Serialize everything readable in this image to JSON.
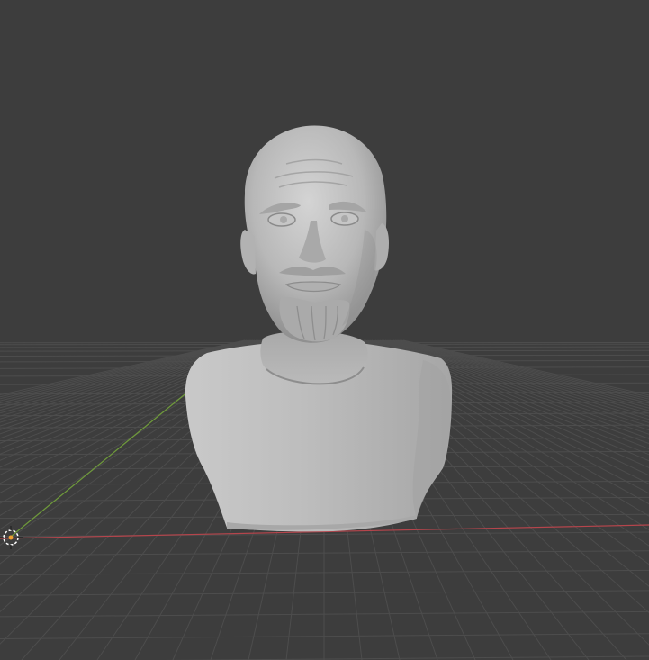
{
  "viewport": {
    "background": "#3d3d3d",
    "grid_color": "#4d4d4d",
    "x_axis_color": "#b5454c",
    "y_axis_color": "#6f9a3b",
    "model_color": "#b9b9b9",
    "model_shadow": "#8e8e8e",
    "origin_marker_color": "#f0a030"
  },
  "scene": {
    "object_type": "sculpted-bust",
    "grid_visible": true,
    "axes_visible": [
      "x",
      "y"
    ]
  },
  "icons": {
    "origin": "3d-cursor-icon"
  }
}
